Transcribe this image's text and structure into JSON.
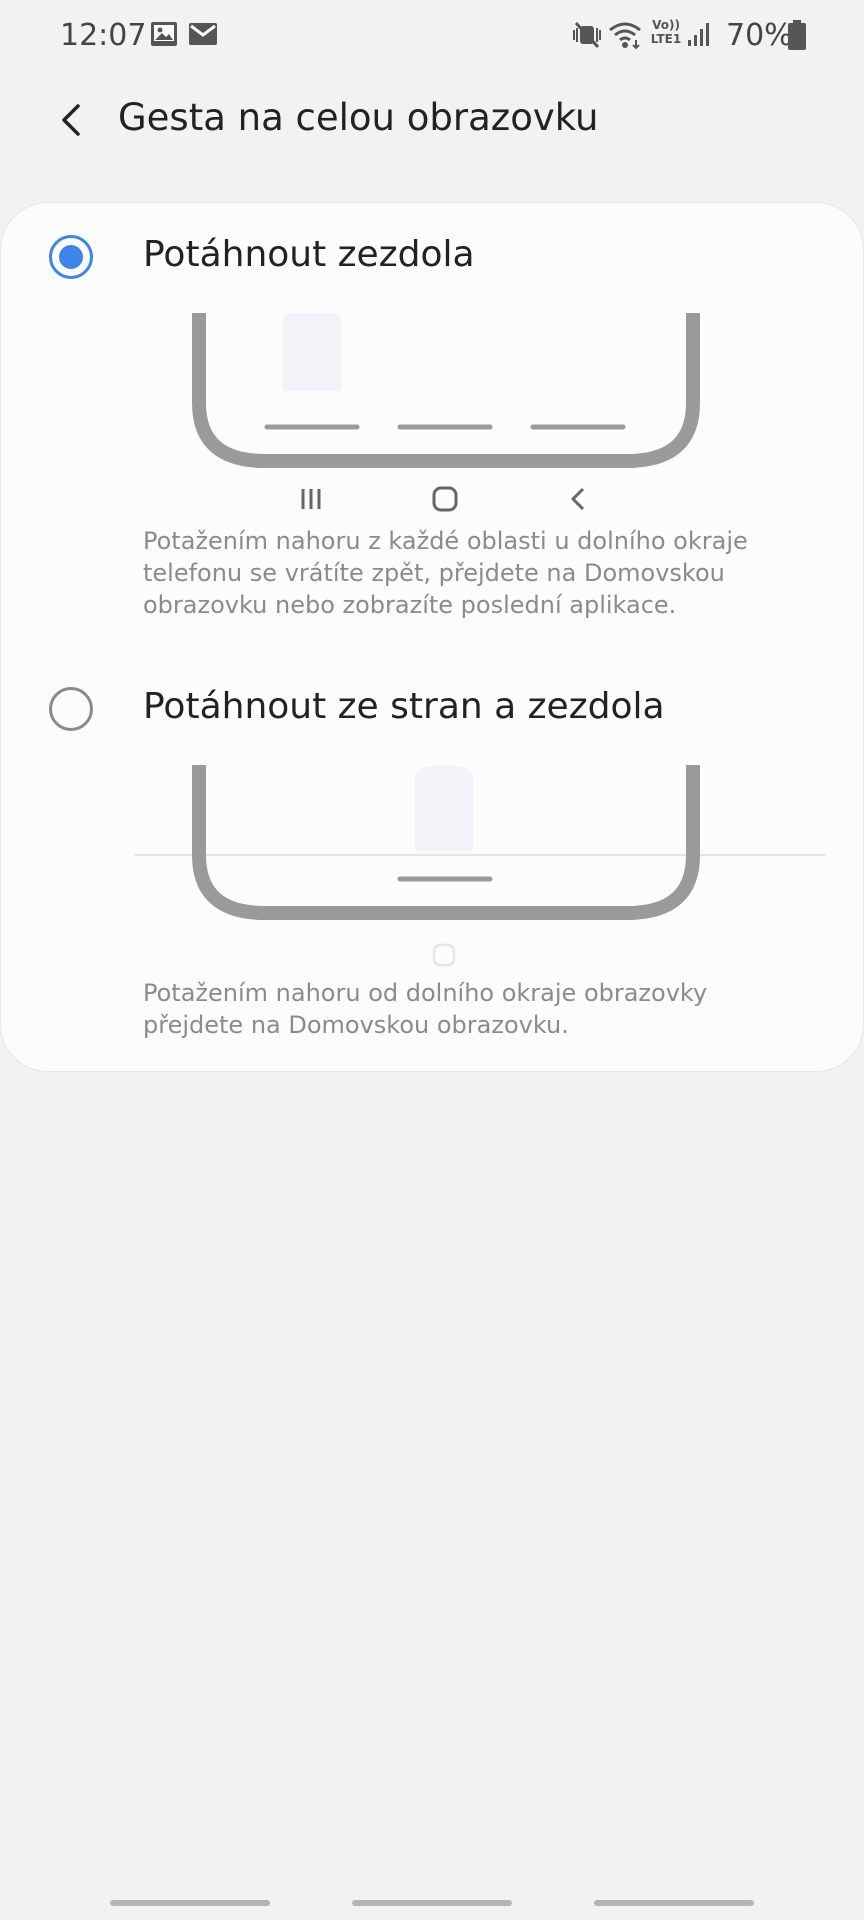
{
  "status_bar": {
    "time": "12:07",
    "battery": "70%",
    "icons": [
      "image-icon",
      "mail-icon",
      "mute-icon",
      "wifi-icon",
      "volte-icon",
      "signal-icon",
      "battery-icon"
    ],
    "volte_top": "Vo))",
    "volte_bottom": "LTE1"
  },
  "app_bar": {
    "title": "Gesta na celou obrazovku",
    "back_icon": "chevron-left-icon"
  },
  "options": [
    {
      "label": "Potáhnout zezdola",
      "selected": true,
      "description": "Potažením nahoru z každé oblasti u dolního okraje telefonu se vrátíte zpět, přejdete na Domovskou obrazovku nebo zobrazíte poslední aplikace."
    },
    {
      "label": "Potáhnout ze stran a zezdola",
      "selected": false,
      "description": "Potažením nahoru od dolního okraje obrazovky přejdete na Domovskou obrazovku."
    }
  ],
  "colors": {
    "accent": "#3d86e8",
    "background": "#f2f2f2",
    "card": "#fcfcfc",
    "illustration": "#9a9a9a"
  }
}
